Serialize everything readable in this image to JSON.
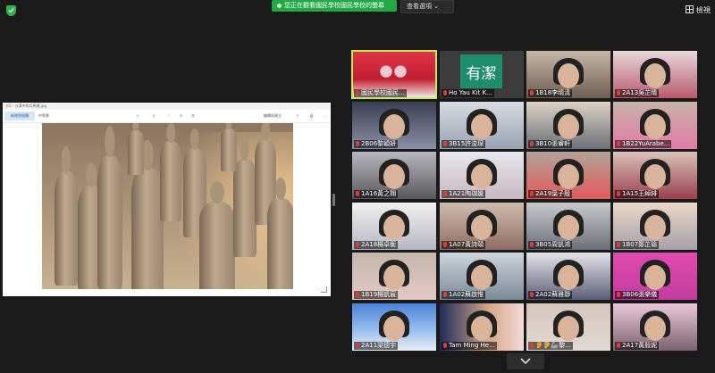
{
  "header": {
    "viewing_label": "您正在觀看國民學校國民學校的螢幕",
    "view_options_label": "查看選項",
    "switch_view_label": "檢視"
  },
  "share": {
    "file_title": "方5 - 沙漠中的兵馬俑.jpg",
    "toolbar_button": "新增到相簿",
    "toolbar_label": "中等景",
    "edit_label": "編輯與建立"
  },
  "participants": [
    {
      "name": "國民學校國民..."
    },
    {
      "name": "Ho Yau Kit K...",
      "avatar_text": "有潔",
      "avatar_color": "#1e8d6c"
    },
    {
      "name": "1B18李晴清"
    },
    {
      "name": "2A13吳芷晴"
    },
    {
      "name": "2B06黎穎妍"
    },
    {
      "name": "3B15許浚琛"
    },
    {
      "name": "3B10張睿軒"
    },
    {
      "name": "1B22YuArabe..."
    },
    {
      "name": "1A16黃之翱"
    },
    {
      "name": "1A21陶珈媛"
    },
    {
      "name": "2A19葉子殷"
    },
    {
      "name": "1A15王綽緋"
    },
    {
      "name": "2A18楊卓衡"
    },
    {
      "name": "1A07黃詩頤"
    },
    {
      "name": "3B05周凱鴻"
    },
    {
      "name": "1B07鄭芷瑜"
    },
    {
      "name": "1B19楊凱宸"
    },
    {
      "name": "1A02蘇啟惟"
    },
    {
      "name": "2A02蘇雅靜"
    },
    {
      "name": "3B06張樂儀"
    },
    {
      "name": "2A11梁德宇"
    },
    {
      "name": "Tam Ming He..."
    },
    {
      "name": "👂🦻🦾黎..."
    },
    {
      "name": "2A17黃毅妮"
    }
  ]
}
